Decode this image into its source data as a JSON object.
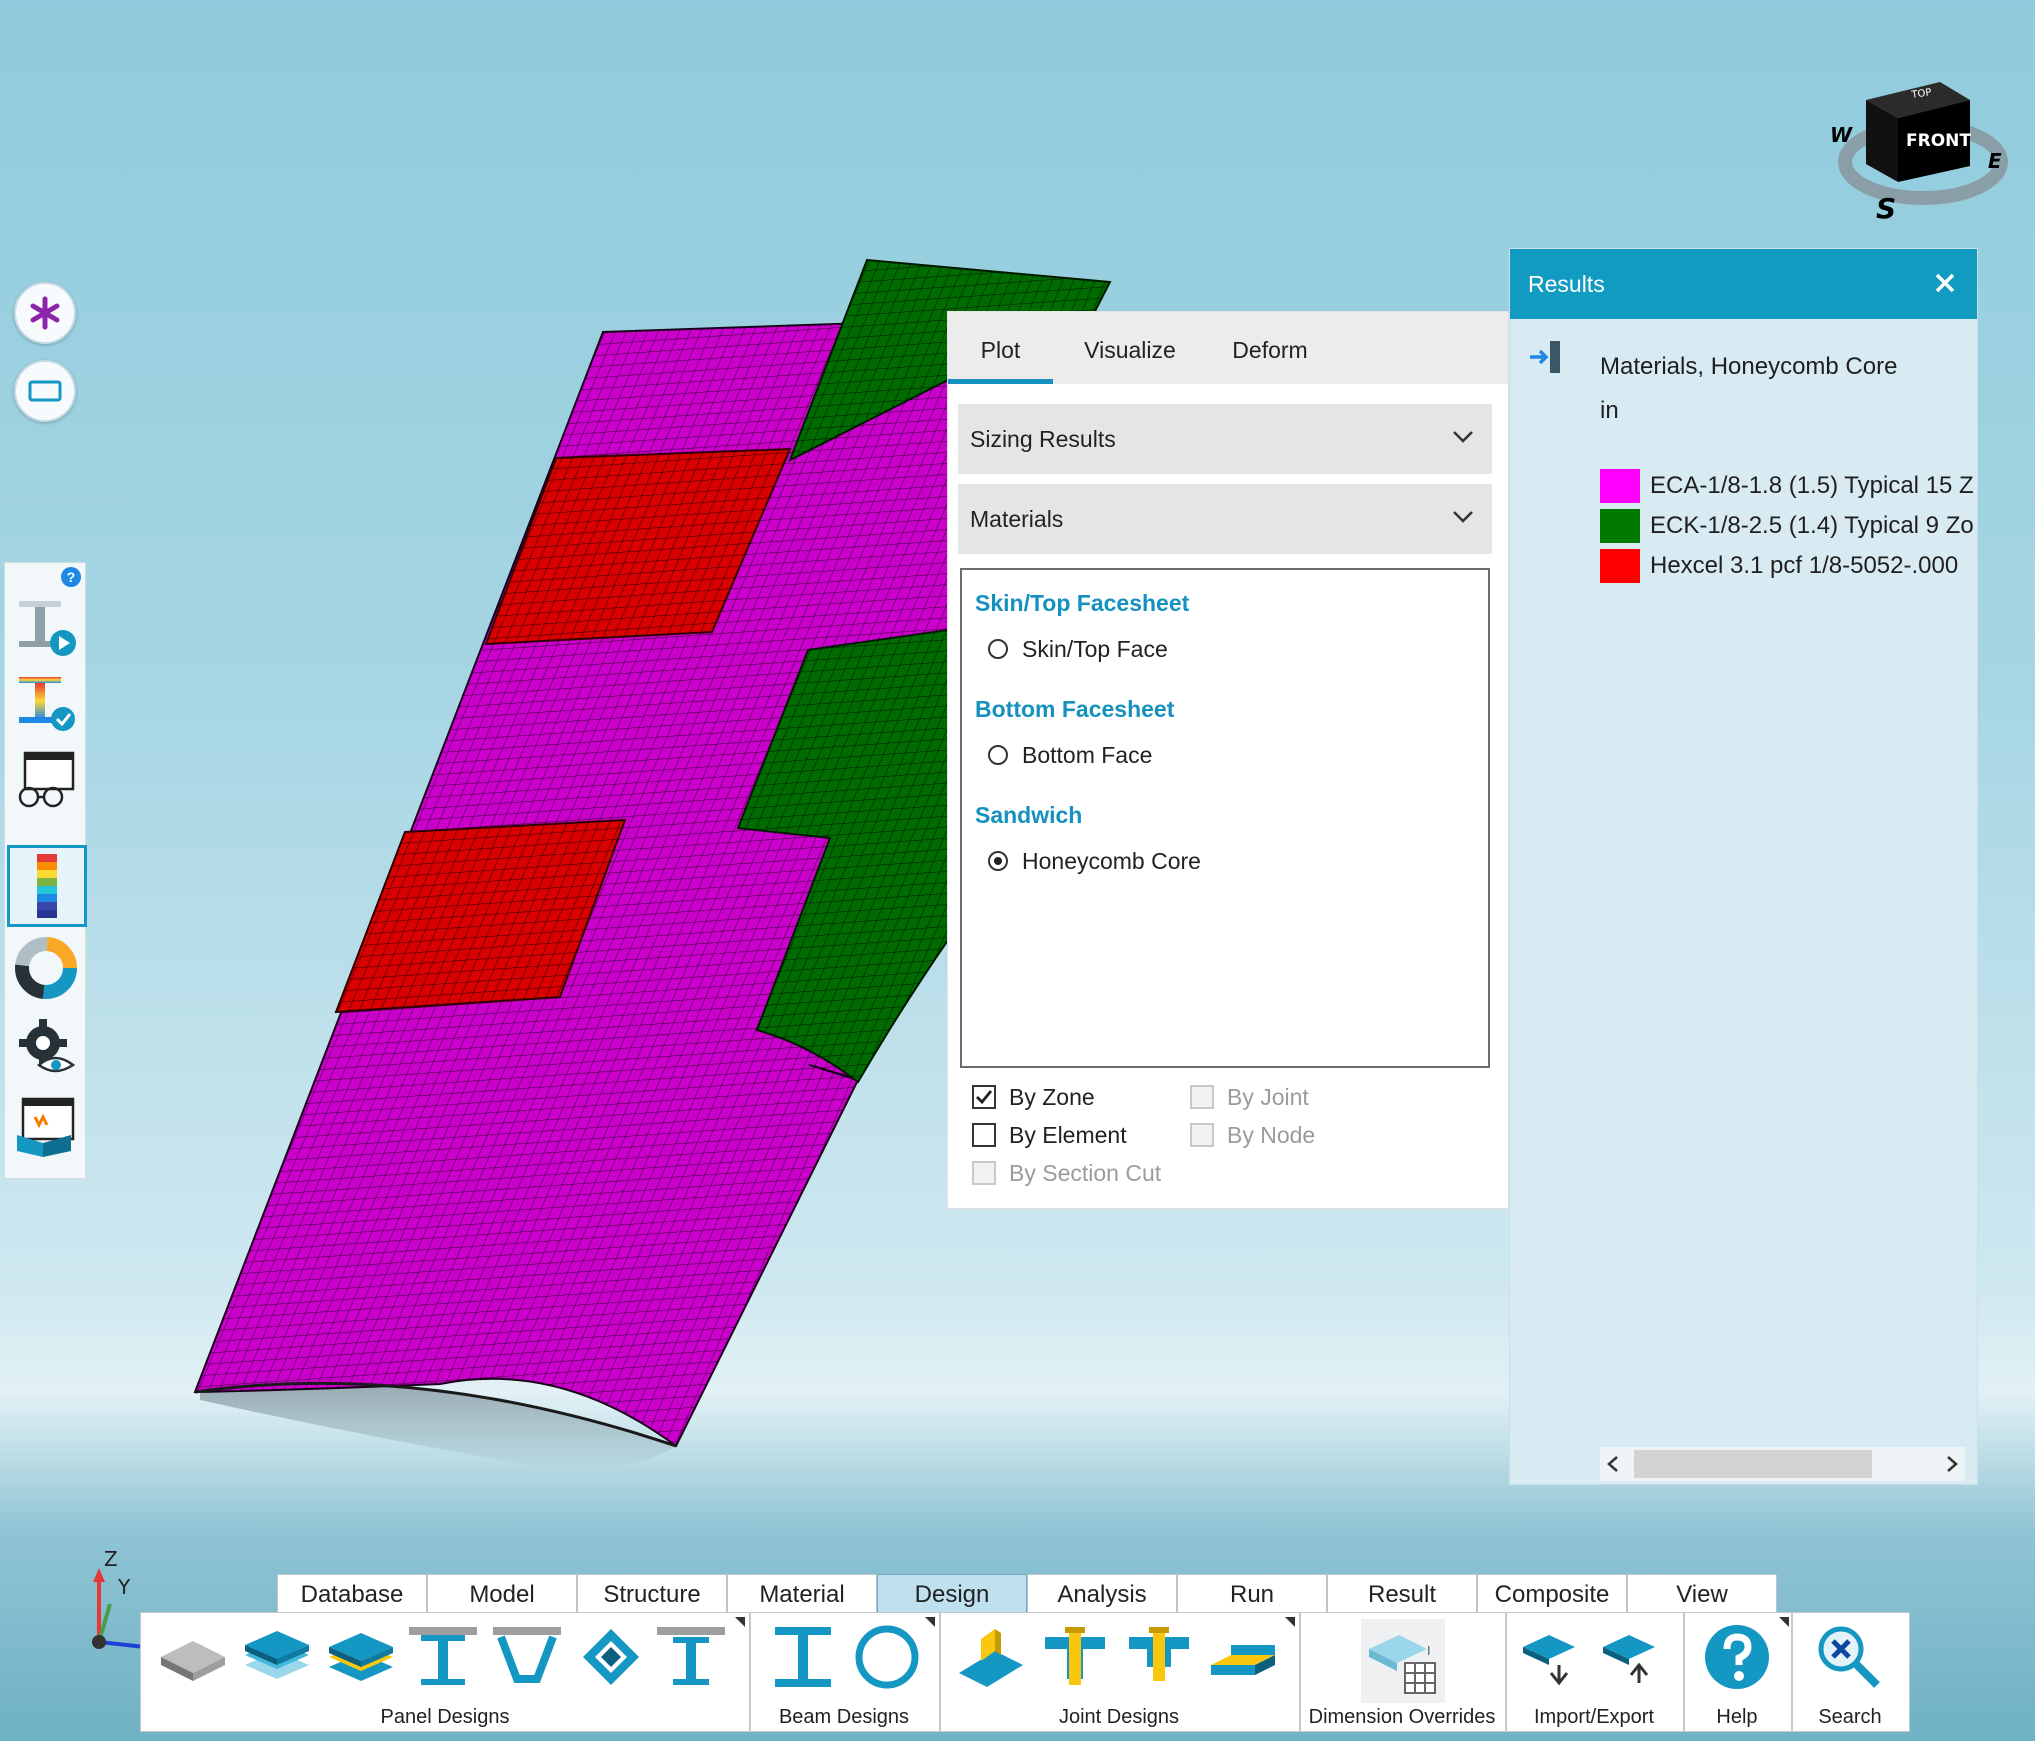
{
  "viewport": {
    "nav_cube": {
      "top": "TOP",
      "front": "FRONT",
      "west": "W",
      "east": "E",
      "south": "S"
    },
    "axis_labels": {
      "z": "Z",
      "y": "Y"
    },
    "colors": {
      "magenta": "#cc00cc",
      "green": "#006b00",
      "red": "#d80000",
      "mesh_line": "#2a002a"
    }
  },
  "left_tools": {
    "top_buttons": [
      "asterisk-icon",
      "rectangle-icon"
    ],
    "help": "?",
    "strip": [
      "beam-play-icon",
      "beam-check-icon",
      "glasses-icon",
      "color-legend-icon",
      "donut-chart-icon",
      "gear-eye-icon",
      "report-icon"
    ]
  },
  "panel": {
    "tabs": [
      "Plot",
      "Visualize",
      "Deform"
    ],
    "active_tab": "Plot",
    "dropdown1": "Sizing Results",
    "dropdown2": "Materials",
    "sections": [
      {
        "title": "Skin/Top Facesheet",
        "option": "Skin/Top Face",
        "selected": false
      },
      {
        "title": "Bottom Facesheet",
        "option": "Bottom Face",
        "selected": false
      },
      {
        "title": "Sandwich",
        "option": "Honeycomb Core",
        "selected": true
      }
    ],
    "checks": {
      "by_zone": "By Zone",
      "by_element": "By Element",
      "by_section_cut": "By Section Cut",
      "by_joint": "By Joint",
      "by_node": "By Node"
    }
  },
  "results": {
    "title": "Results",
    "heading": "Materials, Honeycomb Core",
    "unit": "in",
    "legend": [
      {
        "label": "ECA-1/8-1.8 (1.5) Typical 15 Z",
        "color": "#ff00ff"
      },
      {
        "label": "ECK-1/8-2.5 (1.4) Typical 9 Zo",
        "color": "#007a00"
      },
      {
        "label": "Hexcel 3.1 pcf 1/8-5052-.000",
        "color": "#ff0000"
      }
    ]
  },
  "menu": {
    "tabs": [
      "Database",
      "Model",
      "Structure",
      "Material",
      "Design",
      "Analysis",
      "Run",
      "Result",
      "Composite",
      "View"
    ],
    "active": "Design",
    "groups": {
      "panel_designs": "Panel Designs",
      "beam_designs": "Beam Designs",
      "joint_designs": "Joint Designs",
      "dimension_overrides": "Dimension Overrides",
      "import_export": "Import/Export",
      "help": "Help",
      "search": "Search"
    }
  }
}
